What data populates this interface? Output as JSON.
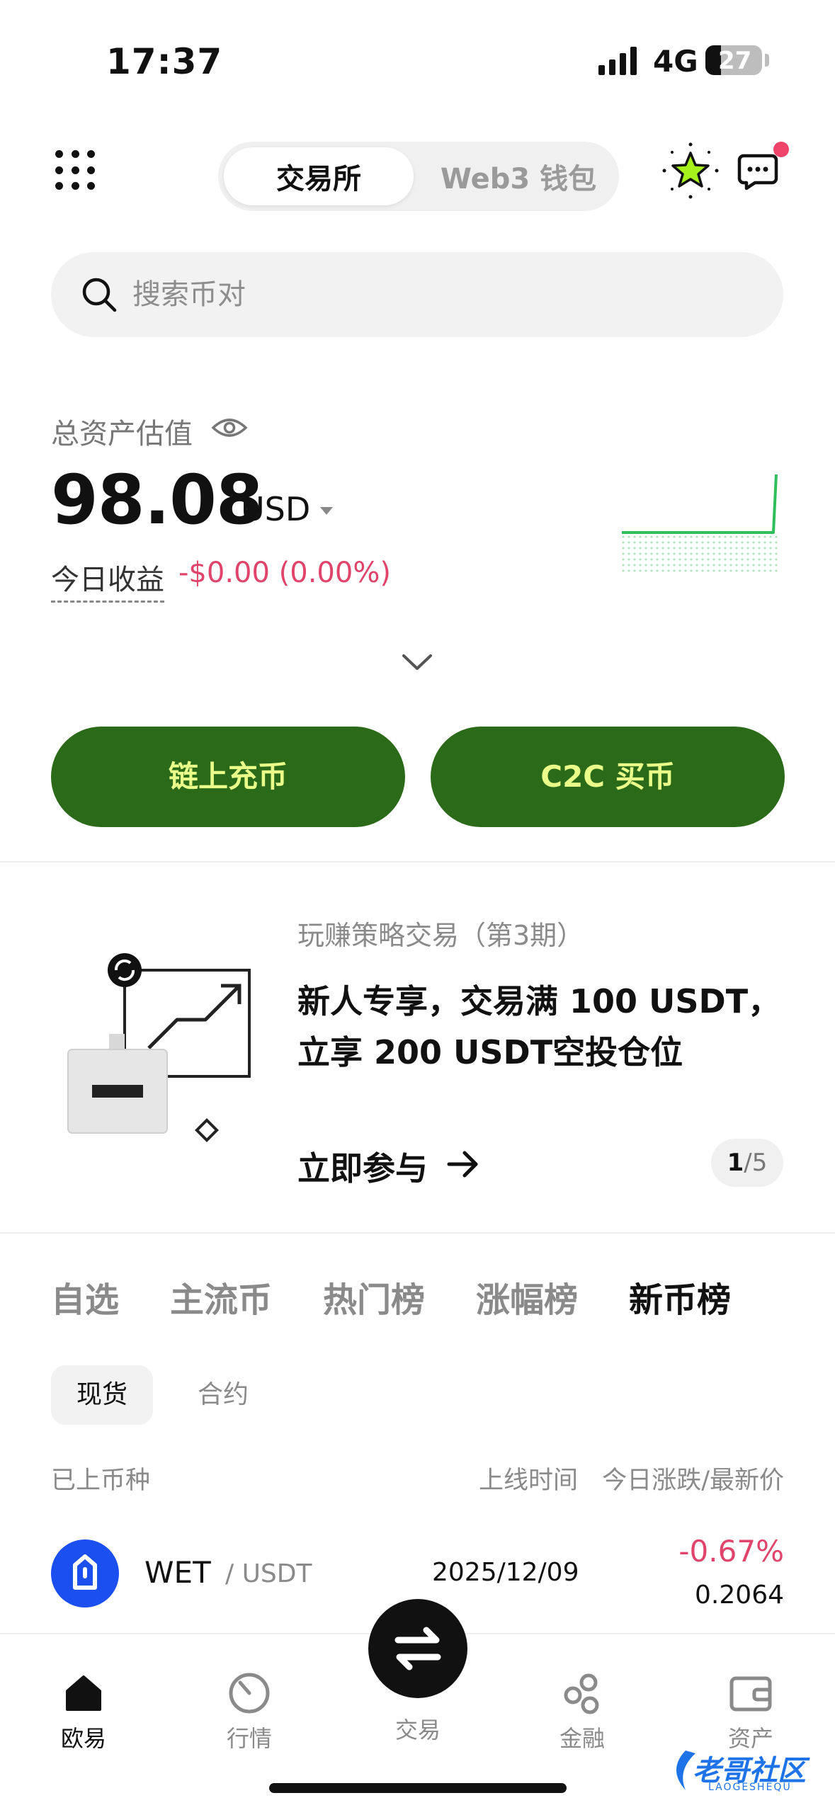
{
  "status_bar": {
    "time": "17:37",
    "network": "4G",
    "battery": "27"
  },
  "header": {
    "tabs": [
      "交易所",
      "Web3 钱包"
    ],
    "active_tab": 0
  },
  "search": {
    "placeholder": "搜索币对"
  },
  "assets": {
    "label": "总资产估值",
    "value": "98.08",
    "unit": "USD",
    "pnl_label": "今日收益",
    "pnl_value": "-$0.00 (0.00%)",
    "color_negative": "#e0446a",
    "color_spark": "#2fbf5a"
  },
  "actions": {
    "deposit": "链上充币",
    "c2c": "C2C 买币",
    "button_color": "#2b6a18",
    "button_text_color": "#e9ff8a"
  },
  "promo": {
    "subtitle": "玩赚策略交易（第3期）",
    "title": "新人专享，交易满 100 USDT，立享 200 USDT空投仓位",
    "cta": "立即参与",
    "pager_current": "1",
    "pager_total": "/5"
  },
  "market": {
    "tabs": [
      "自选",
      "主流币",
      "热门榜",
      "涨幅榜",
      "新币榜"
    ],
    "active_tab": 4,
    "chips": [
      "现货",
      "合约"
    ],
    "headers": {
      "listed": "已上币种",
      "time": "上线时间",
      "change_price": "今日涨跌/最新价"
    },
    "rows": [
      {
        "symbol": "WET",
        "quote": "/ USDT",
        "date": "2025/12/09",
        "change": "-0.67%",
        "price": "0.2064"
      }
    ]
  },
  "nav": {
    "items": [
      "欧易",
      "行情",
      "交易",
      "金融",
      "资产"
    ],
    "active": 0
  },
  "watermark": {
    "text": "老哥社区",
    "small": "LAOGESHEQU"
  }
}
